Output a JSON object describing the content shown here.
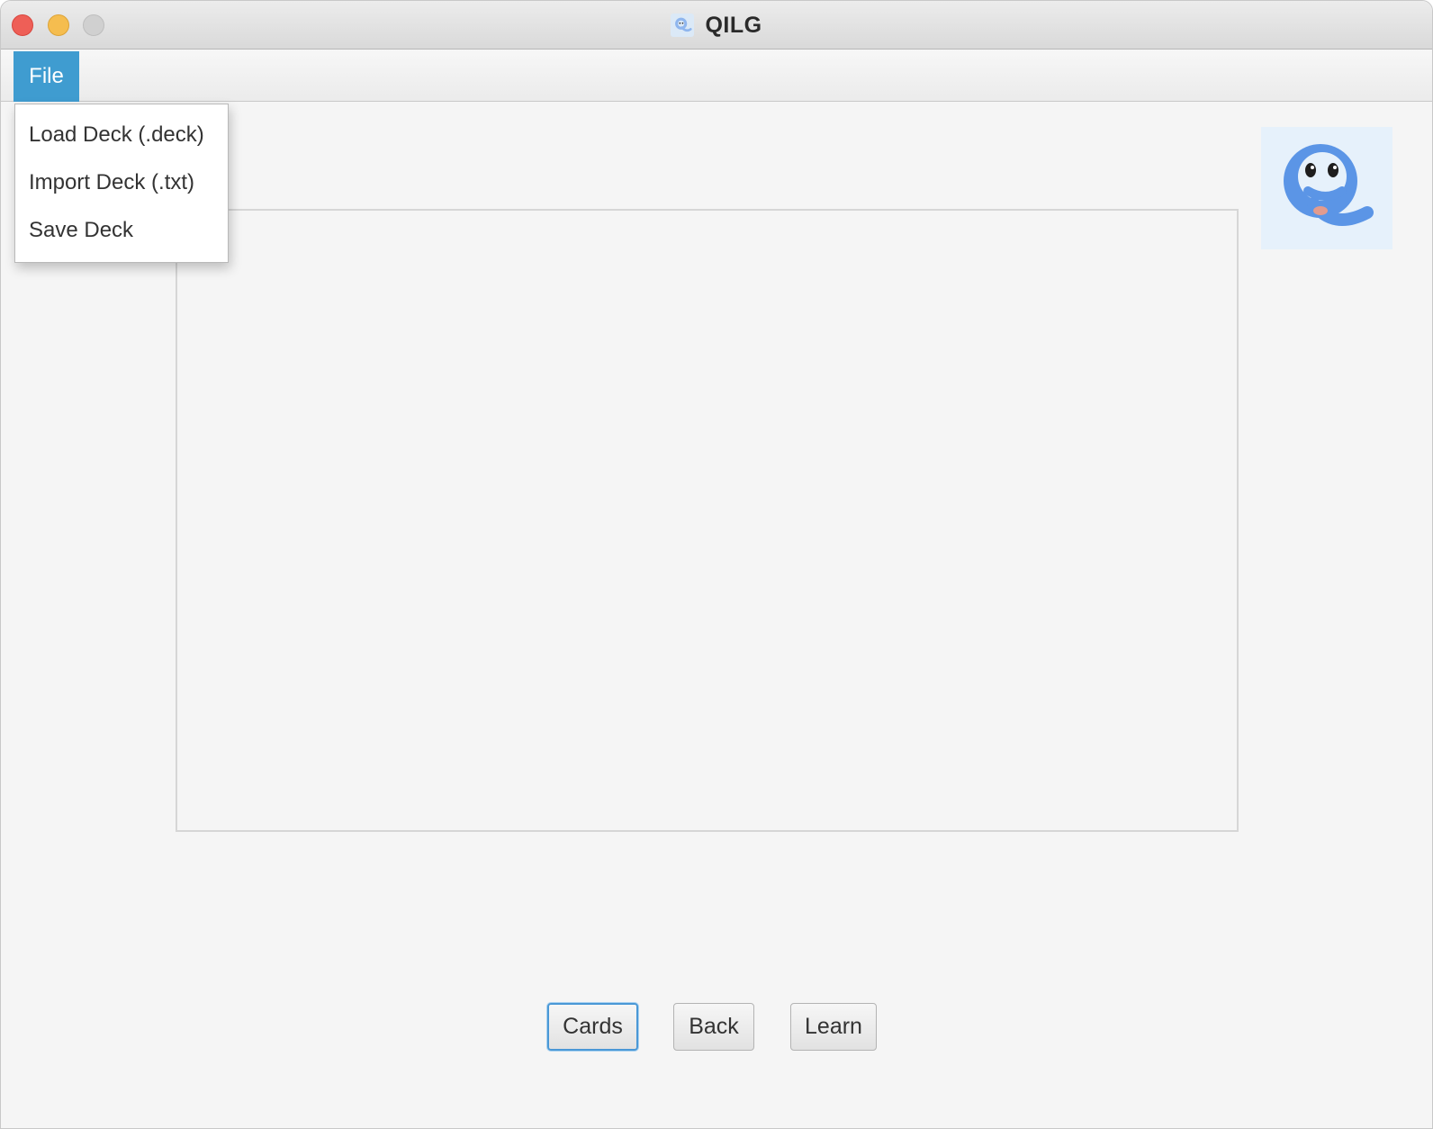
{
  "window": {
    "title": "QILG"
  },
  "menubar": {
    "file_label": "File"
  },
  "file_menu": {
    "items": [
      {
        "label": "Load Deck (.deck)"
      },
      {
        "label": "Import Deck (.txt)"
      },
      {
        "label": "Save Deck"
      }
    ]
  },
  "buttons": {
    "cards_label": "Cards",
    "back_label": "Back",
    "learn_label": "Learn"
  },
  "colors": {
    "menu_highlight": "#3f9cd0",
    "logo_blue": "#5b95e6",
    "focus_ring": "#4a98d6"
  },
  "icons": {
    "app_logo": "qilg-mascot-logo"
  }
}
